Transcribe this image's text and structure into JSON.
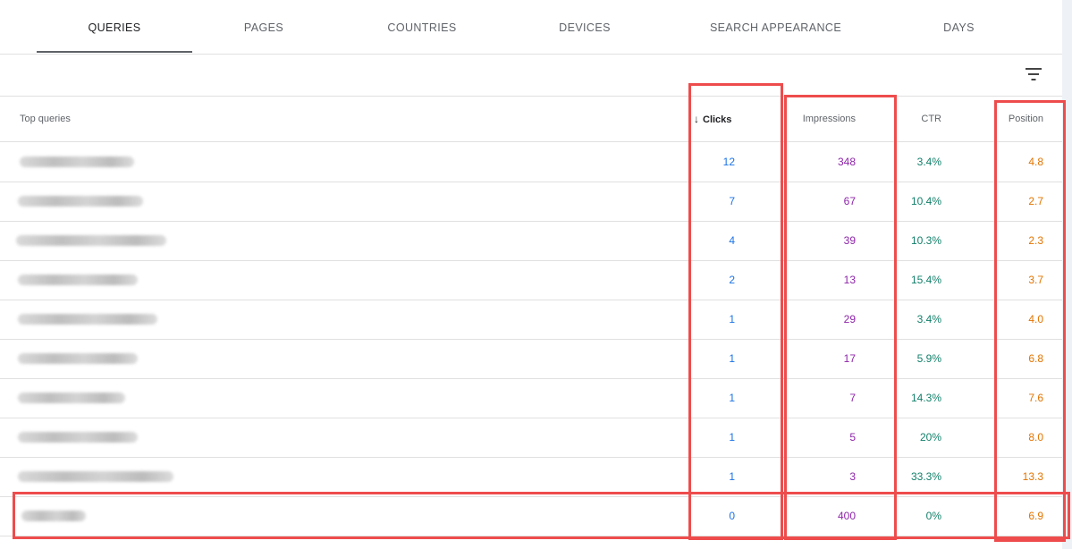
{
  "tabs": [
    {
      "label": "QUERIES",
      "active": true
    },
    {
      "label": "PAGES",
      "active": false
    },
    {
      "label": "COUNTRIES",
      "active": false
    },
    {
      "label": "DEVICES",
      "active": false
    },
    {
      "label": "SEARCH APPEARANCE",
      "active": false
    },
    {
      "label": "DAYS",
      "active": false
    }
  ],
  "filter": {
    "icon": "filter-icon"
  },
  "table": {
    "headers": {
      "query": "Top queries",
      "clicks": "Clicks",
      "impressions": "Impressions",
      "ctr": "CTR",
      "position": "Position"
    },
    "sort": {
      "column": "clicks",
      "direction": "descending",
      "icon": "arrow-down-icon"
    },
    "rows": [
      {
        "clicks": "12",
        "impressions": "348",
        "ctr": "3.4%",
        "position": "4.8"
      },
      {
        "clicks": "7",
        "impressions": "67",
        "ctr": "10.4%",
        "position": "2.7"
      },
      {
        "clicks": "4",
        "impressions": "39",
        "ctr": "10.3%",
        "position": "2.3"
      },
      {
        "clicks": "2",
        "impressions": "13",
        "ctr": "15.4%",
        "position": "3.7"
      },
      {
        "clicks": "1",
        "impressions": "29",
        "ctr": "3.4%",
        "position": "4.0"
      },
      {
        "clicks": "1",
        "impressions": "17",
        "ctr": "5.9%",
        "position": "6.8"
      },
      {
        "clicks": "1",
        "impressions": "7",
        "ctr": "14.3%",
        "position": "7.6"
      },
      {
        "clicks": "1",
        "impressions": "5",
        "ctr": "20%",
        "position": "8.0"
      },
      {
        "clicks": "1",
        "impressions": "3",
        "ctr": "33.3%",
        "position": "13.3"
      },
      {
        "clicks": "0",
        "impressions": "400",
        "ctr": "0%",
        "position": "6.9"
      }
    ]
  },
  "colors": {
    "clicks": "#1a73e8",
    "impressions": "#8e24aa",
    "ctr": "#12806a",
    "position": "#e37400",
    "highlight": "#ee4c4c"
  }
}
